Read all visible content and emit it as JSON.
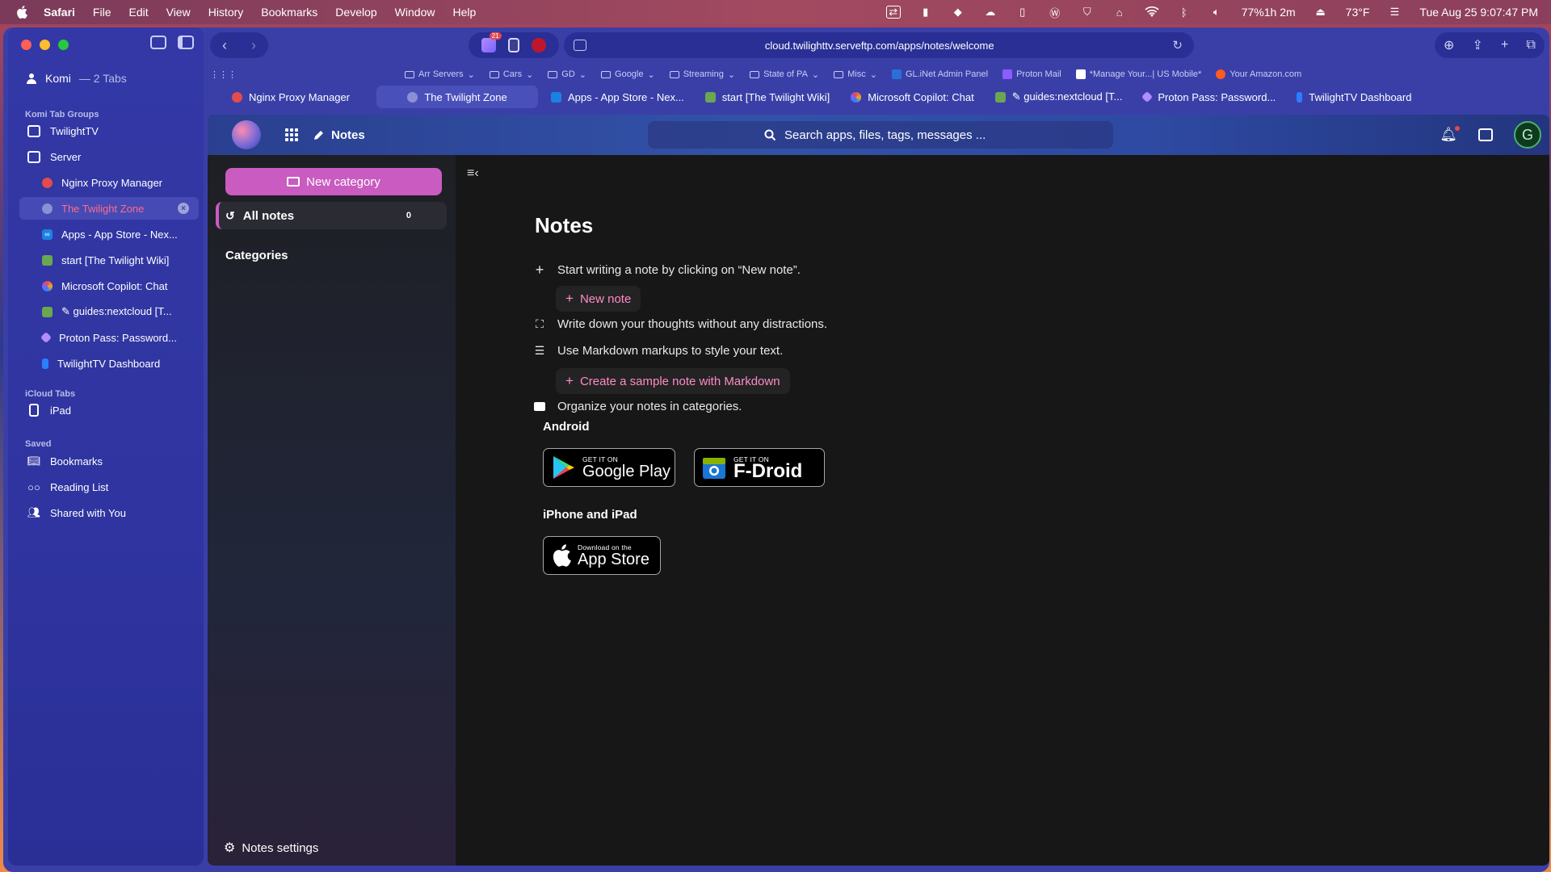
{
  "menubar": {
    "app": "Safari",
    "items": [
      "File",
      "Edit",
      "View",
      "History",
      "Bookmarks",
      "Develop",
      "Window",
      "Help"
    ],
    "battery": "77%1h 2m",
    "weather": "73°F",
    "clock": "Tue Aug 25  9:07:47 PM"
  },
  "sidebar": {
    "profile_name": "Komi",
    "profile_tabs": "— 2 Tabs",
    "groups_heading": "Komi Tab Groups",
    "groups": [
      "TwilightTV",
      "Server"
    ],
    "tabs": [
      {
        "label": "Nginx Proxy Manager",
        "color": "#e24c4c"
      },
      {
        "label": "The Twilight Zone",
        "color": "#8a8fd6"
      },
      {
        "label": "Apps - App Store - Nex...",
        "color": "#1a82e2"
      },
      {
        "label": "start [The Twilight Wiki]",
        "color": "#6aa84f"
      },
      {
        "label": "Microsoft Copilot: Chat",
        "color": "#7b61ff"
      },
      {
        "label": "✎ guides:nextcloud [T...",
        "color": "#6aa84f"
      },
      {
        "label": "Proton Pass: Password...",
        "color": "#b38cff"
      },
      {
        "label": "TwilightTV Dashboard",
        "color": "#2b7fff"
      }
    ],
    "icloud_heading": "iCloud Tabs",
    "icloud_device": "iPad",
    "saved_heading": "Saved",
    "saved": [
      "Bookmarks",
      "Reading List",
      "Shared with You"
    ]
  },
  "toolbar": {
    "badge": "21",
    "url": "cloud.twilighttv.serveftp.com/apps/notes/welcome"
  },
  "favorites": [
    "Arr Servers",
    "Cars",
    "GD",
    "Google",
    "Streaming",
    "State of PA",
    "Misc",
    "GL.iNet Admin Panel",
    "Proton Mail",
    "*Manage Your...| US Mobile*",
    "Your Amazon.com"
  ],
  "tabs": [
    {
      "label": "Nginx Proxy Manager",
      "color": "#e24c4c"
    },
    {
      "label": "The Twilight Zone",
      "color": "#8a8fd6"
    },
    {
      "label": "Apps - App Store - Nex...",
      "color": "#1a82e2"
    },
    {
      "label": "start [The Twilight Wiki]",
      "color": "#6aa84f"
    },
    {
      "label": "Microsoft Copilot: Chat",
      "color": "#7b61ff"
    },
    {
      "label": "✎ guides:nextcloud [T...",
      "color": "#6aa84f"
    },
    {
      "label": "Proton Pass: Password...",
      "color": "#b38cff"
    },
    {
      "label": "TwilightTV Dashboard",
      "color": "#2b7fff"
    }
  ],
  "nextcloud": {
    "app_name": "Notes",
    "search_placeholder": "Search apps, files, tags, messages ...",
    "avatar_letter": "G"
  },
  "notes_nav": {
    "new_category": "New category",
    "all_notes": "All notes",
    "all_notes_count": "0",
    "categories": "Categories",
    "settings": "Notes settings"
  },
  "welcome": {
    "title": "Notes",
    "tip1": "Start writing a note by clicking on “New note”.",
    "new_note": "New note",
    "tip2": "Write down your thoughts without any distractions.",
    "tip3": "Use Markdown markups to style your text.",
    "sample_note": "Create a sample note with Markdown",
    "tip4": "Organize your notes in categories.",
    "android": "Android",
    "ios": "iPhone and iPad",
    "google_play_small": "GET IT ON",
    "google_play_big": "Google Play",
    "fdroid_small": "GET IT ON",
    "fdroid_big": "F-Droid",
    "appstore_small": "Download on the",
    "appstore_big": "App Store"
  },
  "colors": {
    "accent": "#c95bc1",
    "link": "#ff8ac8",
    "window": "#3a3fa8"
  }
}
